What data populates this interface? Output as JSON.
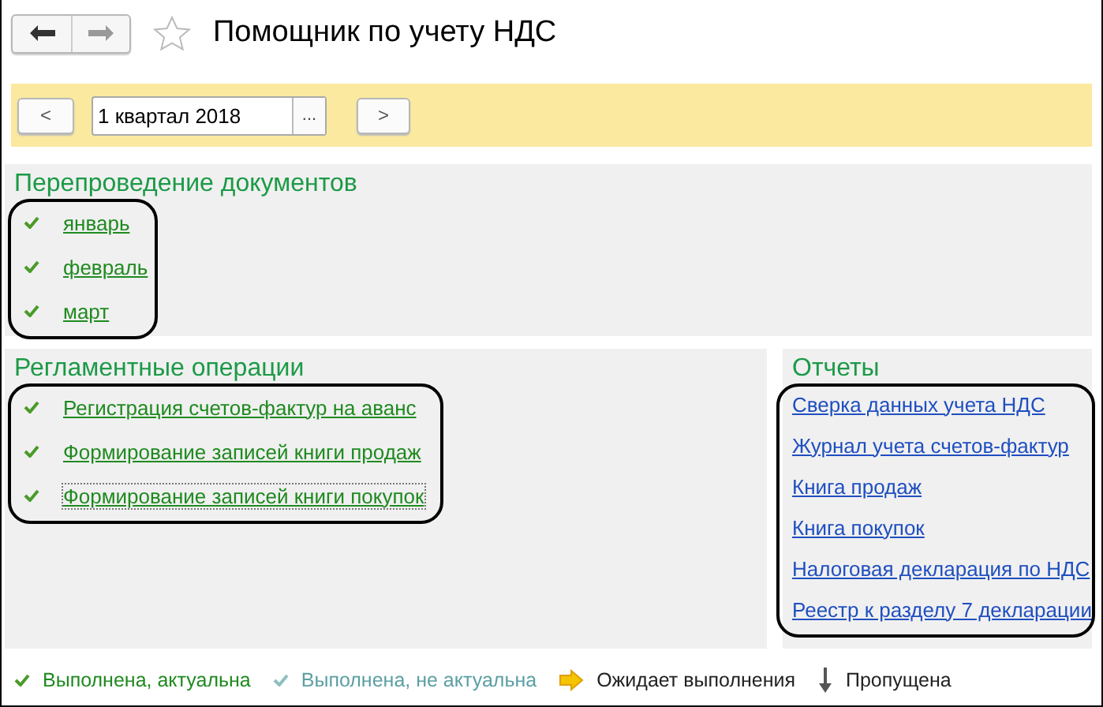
{
  "window": {
    "title": "Помощник по учету НДС",
    "favorite": false
  },
  "period": {
    "prev": "<",
    "value": "1 квартал 2018",
    "choose": "...",
    "next": ">"
  },
  "reposting": {
    "title": "Перепроведение документов",
    "items": [
      {
        "label": "январь",
        "kind": "done"
      },
      {
        "label": "февраль",
        "kind": "done"
      },
      {
        "label": "март",
        "kind": "done"
      }
    ]
  },
  "operations": {
    "title": "Регламентные операции",
    "items": [
      {
        "label": "Регистрация счетов-фактур на аванс",
        "kind": "done",
        "focused": false
      },
      {
        "label": "Формирование записей книги продаж",
        "kind": "done",
        "focused": false
      },
      {
        "label": "Формирование записей книги покупок",
        "kind": "done",
        "focused": true
      }
    ]
  },
  "reports": {
    "title": "Отчеты",
    "items": [
      "Сверка данных учета НДС",
      "Журнал учета счетов-фактур",
      "Книга продаж",
      "Книга покупок",
      "Налоговая декларация по НДС",
      "Реестр к разделу 7 декларации"
    ]
  },
  "legend": [
    {
      "kind": "done",
      "label": "Выполнена, актуальна"
    },
    {
      "kind": "stale",
      "label": "Выполнена, не актуальна"
    },
    {
      "kind": "pending",
      "label": "Ожидает выполнения"
    },
    {
      "kind": "skipped",
      "label": "Пропущена"
    }
  ]
}
